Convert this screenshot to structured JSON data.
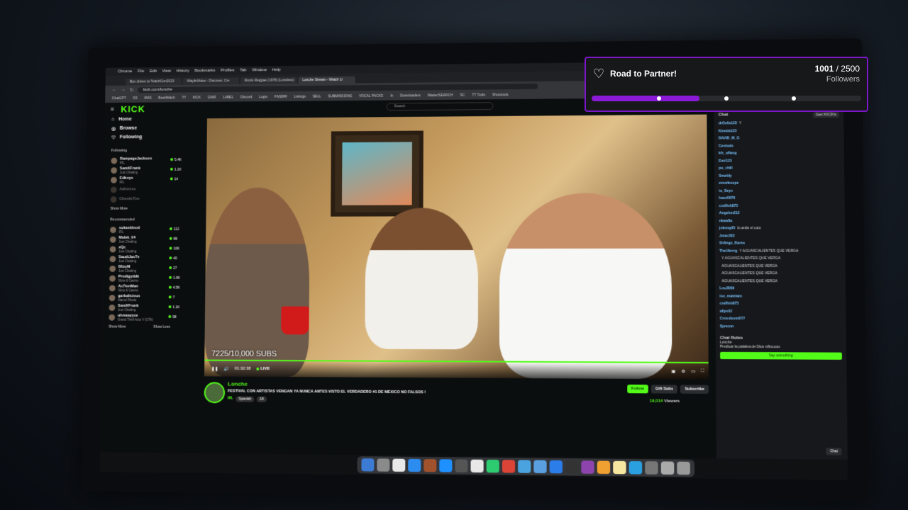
{
  "browser": {
    "menu": [
      "Chrome",
      "File",
      "Edit",
      "View",
      "History",
      "Bookmarks",
      "Profiles",
      "Tab",
      "Window",
      "Help"
    ],
    "tabs": [
      "Bon drives to TwitchCon2023",
      "WaylinVideo - Discover, Cre",
      "Roots Reggae (1978) (Lossless)",
      "Lonche Stream - Watch Li"
    ],
    "url": "kick.com/lonche",
    "bookmarks": [
      "ChatGPT",
      "SS",
      "MAS",
      "BeetWatch",
      "TT",
      "KICK",
      "GWR",
      "LABEL",
      "Discord",
      "Login",
      "FIVERR",
      "Listings",
      "SELL",
      "SUBMISSIONS",
      "VOCAL PACKS",
      "In",
      "Downloaders",
      "MasterSEARCH",
      "SC",
      "TT Tools",
      "Shoutouts"
    ]
  },
  "kick": {
    "logo": "KICK",
    "search_placeholder": "Search",
    "nav": [
      "Home",
      "Browse",
      "Following"
    ],
    "following_header": "Following",
    "following": [
      {
        "name": "RampageJackson",
        "sub": "IRL",
        "count": "5.4K"
      },
      {
        "name": "SamXFrank",
        "sub": "Just Chatting",
        "count": "1.1K"
      },
      {
        "name": "Edboys",
        "sub": "IRL",
        "count": "14"
      },
      {
        "name": "Adinross",
        "sub": "",
        "count": ""
      },
      {
        "name": "ChasticToo",
        "sub": "",
        "count": ""
      }
    ],
    "show_more": "Show More",
    "recommended_header": "Recommended",
    "recommended": [
      {
        "name": "sukasblood",
        "sub": "IRL",
        "count": "112"
      },
      {
        "name": "Malek_04",
        "sub": "Just Chatting",
        "count": "86"
      },
      {
        "name": "xQc",
        "sub": "Just Chatting",
        "count": "10K"
      },
      {
        "name": "SaudiJasTv",
        "sub": "Just Chatting",
        "count": "40"
      },
      {
        "name": "BlizyM",
        "sub": "Just Chatting",
        "count": "27"
      },
      {
        "name": "Prodigyddk",
        "sub": "Slots & Casino",
        "count": "1.6K"
      },
      {
        "name": "Ac7ionMan",
        "sub": "Slots & Casino",
        "count": "4.5K"
      },
      {
        "name": "garbalicious",
        "sub": "Marvel Rivals",
        "count": "7"
      },
      {
        "name": "SamXFrank",
        "sub": "Just Chatting",
        "count": "1.1K"
      },
      {
        "name": "uhmaayyze",
        "sub": "Grand Theft Auto V (GTA)",
        "count": "98"
      }
    ],
    "show_more2": "Show More",
    "show_less": "Show Less"
  },
  "player": {
    "subs_overlay": "7225/10,000 SUBS",
    "time": "01:32:38",
    "live": "LIVE"
  },
  "stream": {
    "streamer": "Lonche",
    "title": "FESTIVAL CON ARTISTAS VENGAN YA NUNCA ANTES VISTO EL VERDADERO #1 DE MEXICO NO FALSOS !",
    "category": "IRL",
    "tags": [
      "Spanish",
      "18"
    ],
    "follow": "Follow",
    "gift": "Gift Subs",
    "subscribe": "Subscribe",
    "viewers": "19,014",
    "viewers_label": "Viewers"
  },
  "chat": {
    "header": "Chat",
    "get_btn": "Get KICKs",
    "messages": [
      {
        "u": "drOx0x123",
        "t": "Y"
      },
      {
        "u": "Kmeda123",
        "t": ""
      },
      {
        "u": "DAVID_M_G",
        "t": ""
      },
      {
        "u": "Cerdudo",
        "t": ""
      },
      {
        "u": "kfc_aflang",
        "t": ""
      },
      {
        "u": "Enri123",
        "t": ""
      },
      {
        "u": "pu_chill",
        "t": ""
      },
      {
        "u": "Smeldy",
        "t": ""
      },
      {
        "u": "encafesepe",
        "t": ""
      },
      {
        "u": "iu_Seyo",
        "t": ""
      },
      {
        "u": "haxz0876",
        "t": ""
      },
      {
        "u": "codfish875",
        "t": ""
      },
      {
        "u": "Angelon212",
        "t": ""
      },
      {
        "u": "nkaw8a",
        "t": ""
      },
      {
        "u": "jokong65",
        "t": "lo ardio el culo"
      },
      {
        "u": "Jotac302",
        "t": ""
      },
      {
        "u": "Sirlings_Barns",
        "t": ""
      },
      {
        "u": "TheUbrrrg",
        "t": "Y AGUASCALIENTES QUE VERGA"
      },
      {
        "u": "",
        "t": "Y AGUASCALIENTES QUE VERGA"
      },
      {
        "u": "",
        "t": "AGUASCALIENTES QUE VERGA"
      },
      {
        "u": "",
        "t": "AGUASCALIENTES QUE VERGA"
      },
      {
        "u": "",
        "t": "AGUASCALIENTES QUE VERGA"
      },
      {
        "u": "Lou3009",
        "t": ""
      },
      {
        "u": "iso_maintain",
        "t": ""
      },
      {
        "u": "codfish875",
        "t": ""
      },
      {
        "u": "allyo02",
        "t": ""
      },
      {
        "u": "Crosskoon877",
        "t": ""
      },
      {
        "u": "Sjevcon",
        "t": ""
      }
    ],
    "rules_title": "Chat Rules",
    "rules_author": "Lonche",
    "rules_text": "Predicar la palabra de Dios niñocooo",
    "input_placeholder": "Say something",
    "chat_btn": "Chat"
  },
  "widget": {
    "title": "Road to Partner!",
    "current": "1001",
    "goal": "2500",
    "label": "Followers",
    "progress": 0.4,
    "markers": [
      0.25,
      0.5,
      0.75
    ],
    "accent": "#8a1ad6",
    "border": "#7b16c9"
  },
  "colors": {
    "kick_green": "#53fc18"
  }
}
